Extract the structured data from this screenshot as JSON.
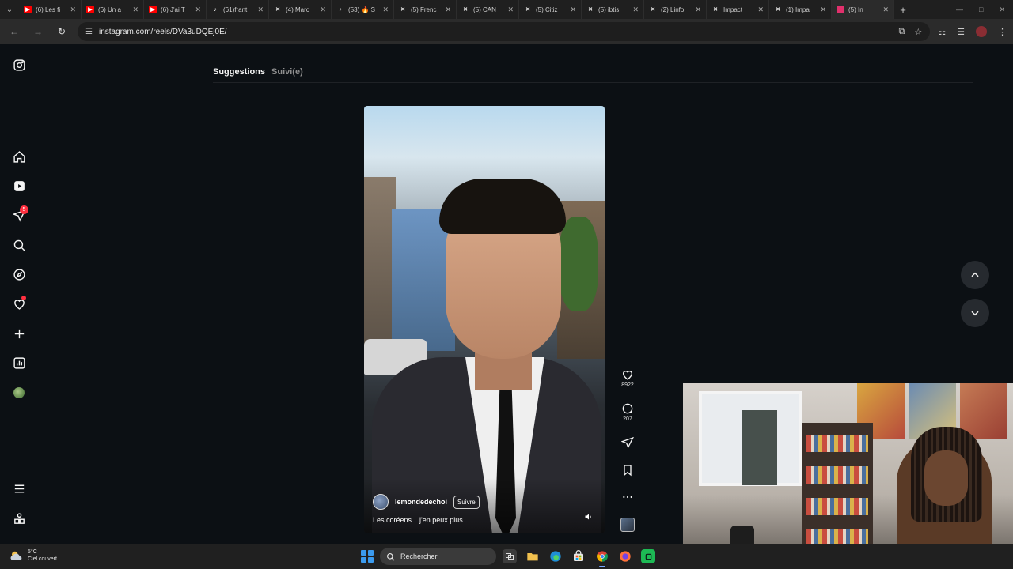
{
  "browser": {
    "tabs": [
      {
        "title": "(6) Les fi",
        "fav": "youtube",
        "color": "#ff0000"
      },
      {
        "title": "(6) Un a",
        "fav": "youtube",
        "color": "#ff0000"
      },
      {
        "title": "(6) J'ai T",
        "fav": "youtube",
        "color": "#ff0000"
      },
      {
        "title": "(61)frant",
        "fav": "tiktok",
        "color": "#ffffff"
      },
      {
        "title": "(4) Marc",
        "fav": "x",
        "color": "#ffffff"
      },
      {
        "title": "(53) 🔥 S",
        "fav": "tiktok",
        "color": "#ffffff"
      },
      {
        "title": "(5) Frenc",
        "fav": "x",
        "color": "#ffffff"
      },
      {
        "title": "(5) CAN",
        "fav": "x",
        "color": "#ffffff"
      },
      {
        "title": "(5) Citiz",
        "fav": "x",
        "color": "#ffffff"
      },
      {
        "title": "(5) ibtis",
        "fav": "x",
        "color": "#ffffff"
      },
      {
        "title": "(2) Linfo",
        "fav": "x",
        "color": "#ffffff"
      },
      {
        "title": "Impact",
        "fav": "x",
        "color": "#ffffff"
      },
      {
        "title": "(1) Impa",
        "fav": "x",
        "color": "#ffffff"
      },
      {
        "title": "(5) In",
        "fav": "instagram",
        "color": "#e1306c"
      }
    ],
    "url": "instagram.com/reels/DVa3uDQEj0E/"
  },
  "instagram": {
    "feed_tabs": {
      "suggestions": "Suggestions",
      "following": "Suivi(e)"
    },
    "notifications_badge": "5",
    "reel": {
      "author": "lemondedechoi",
      "follow_label": "Suivre",
      "caption": "Les coréens... j'en peux plus",
      "likes": "8922",
      "comments": "207"
    }
  },
  "taskbar": {
    "temperature": "5°C",
    "condition": "Ciel couvert",
    "search_label": "Rechercher"
  },
  "colors": {
    "bg": "#0c1014",
    "accent_badge": "#ff3040",
    "start": "#3b9bef"
  }
}
